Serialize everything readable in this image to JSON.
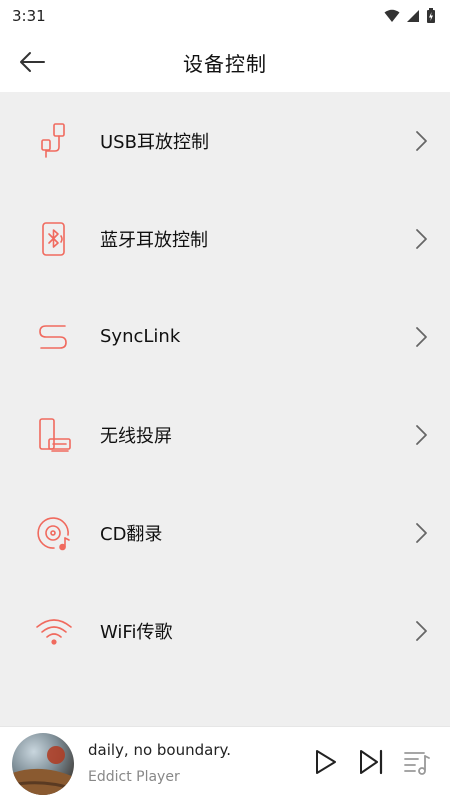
{
  "status_bar": {
    "time": "3:31"
  },
  "app_bar": {
    "title": "设备控制"
  },
  "menu": {
    "items": [
      {
        "label": "USB耳放控制",
        "icon": "usb-cable-icon"
      },
      {
        "label": "蓝牙耳放控制",
        "icon": "bluetooth-device-icon"
      },
      {
        "label": "SyncLink",
        "icon": "synclink-icon"
      },
      {
        "label": "无线投屏",
        "icon": "wireless-cast-icon"
      },
      {
        "label": "CD翻录",
        "icon": "cd-rip-icon"
      },
      {
        "label": "WiFi传歌",
        "icon": "wifi-icon"
      }
    ]
  },
  "player": {
    "title": "daily, no boundary.",
    "artist": "Eddict Player"
  },
  "colors": {
    "accent": "#f06a5e",
    "list_background": "#efefef",
    "chevron": "#666666"
  }
}
